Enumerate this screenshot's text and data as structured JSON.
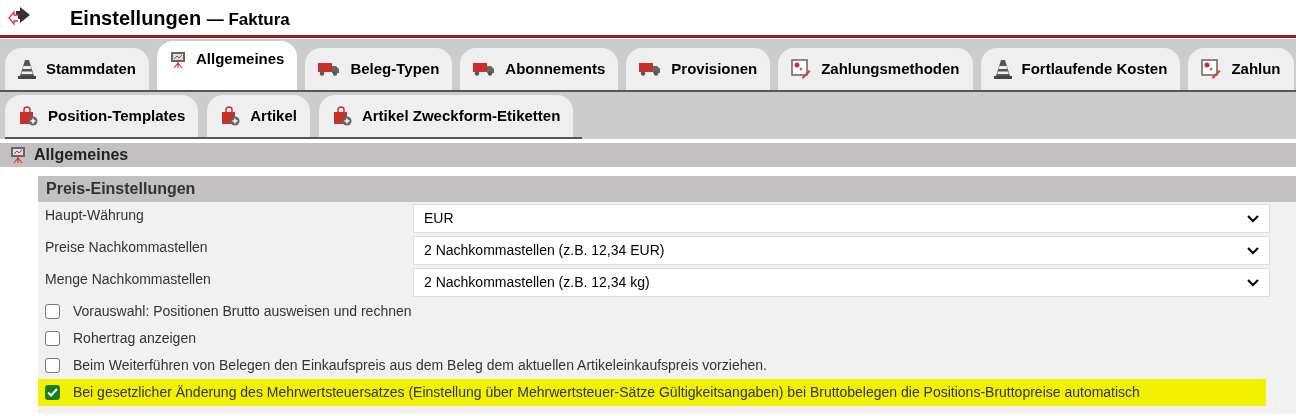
{
  "header": {
    "title": "Einstellungen",
    "subtitle": "— Faktura"
  },
  "tabs": [
    {
      "label": "Stammdaten",
      "kind": "cone",
      "selected": false
    },
    {
      "label": "Allgemeines",
      "kind": "board",
      "selected": true
    },
    {
      "label": "Beleg-Typen",
      "kind": "truck",
      "selected": false
    },
    {
      "label": "Abonnements",
      "kind": "truck",
      "selected": false
    },
    {
      "label": "Provisionen",
      "kind": "truck",
      "selected": false
    },
    {
      "label": "Zahlungsmethoden",
      "kind": "edit",
      "selected": false
    },
    {
      "label": "Fortlaufende Kosten",
      "kind": "cone",
      "selected": false
    },
    {
      "label": "Zahlun",
      "kind": "edit",
      "selected": false
    }
  ],
  "subtabs": [
    {
      "label": "Position-Templates",
      "kind": "bag",
      "selected": false
    },
    {
      "label": "Artikel",
      "kind": "bag",
      "selected": false
    },
    {
      "label": "Artikel Zweckform-Etiketten",
      "kind": "bag",
      "selected": false
    }
  ],
  "section": {
    "title": "Allgemeines"
  },
  "panel": {
    "title": "Preis-Einstellungen",
    "fields": [
      {
        "label": "Haupt-Währung",
        "value": "EUR"
      },
      {
        "label": "Preise Nachkommastellen",
        "value": "2 Nachkommastellen (z.B. 12,34 EUR)"
      },
      {
        "label": "Menge Nachkommastellen",
        "value": "2 Nachkommastellen (z.B. 12,34 kg)"
      }
    ],
    "options": [
      {
        "label": "Vorauswahl: Positionen Brutto ausweisen und rechnen",
        "checked": false,
        "highlighted": false
      },
      {
        "label": "Rohertrag anzeigen",
        "checked": false,
        "highlighted": false
      },
      {
        "label": "Beim Weiterführen von Belegen den Einkaufspreis aus dem Beleg dem aktuellen Artikeleinkaufspreis vorziehen.",
        "checked": false,
        "highlighted": false
      },
      {
        "label": "Bei gesetzlicher Änderung des Mehrwertsteuersatzes (Einstellung über Mehrwertsteuer-Sätze Gültigkeitsangaben) bei Bruttobelegen die Positions-Bruttopreise automatisch",
        "checked": true,
        "highlighted": true
      }
    ]
  }
}
